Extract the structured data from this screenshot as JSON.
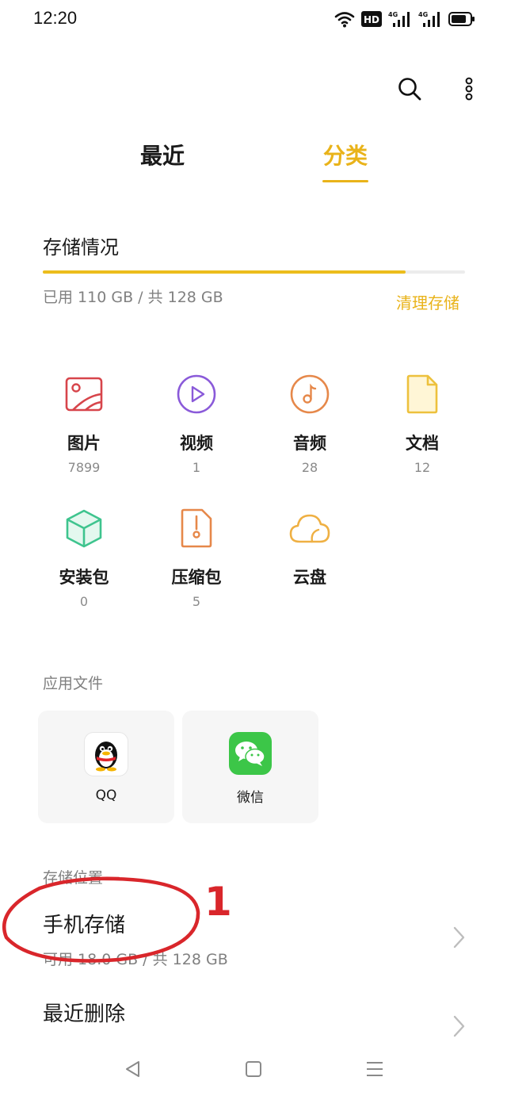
{
  "status_bar": {
    "time": "12:20",
    "icons": [
      "wifi-icon",
      "hd-icon",
      "signal-4g-icon",
      "signal-4g-icon",
      "battery-icon"
    ]
  },
  "toolbar": {
    "icons": [
      "search-icon",
      "more-vertical-icon"
    ]
  },
  "tabs": [
    {
      "label": "最近",
      "active": false
    },
    {
      "label": "分类",
      "active": true
    }
  ],
  "storage": {
    "title": "存储情况",
    "used_text": "已用 110 GB / 共 128 GB",
    "used_fraction": 0.86,
    "clean_label": "清理存储"
  },
  "categories": [
    {
      "label": "图片",
      "count": "7899",
      "icon": "image-icon",
      "color": "#d7454b"
    },
    {
      "label": "视频",
      "count": "1",
      "icon": "video-play-icon",
      "color": "#8a5ad9"
    },
    {
      "label": "音频",
      "count": "28",
      "icon": "music-note-icon",
      "color": "#e6884a"
    },
    {
      "label": "文档",
      "count": "12",
      "icon": "document-icon",
      "color": "#edc13d"
    },
    {
      "label": "安装包",
      "count": "0",
      "icon": "package-cube-icon",
      "color": "#3ec48e"
    },
    {
      "label": "压缩包",
      "count": "5",
      "icon": "zip-file-icon",
      "color": "#e6884a"
    },
    {
      "label": "云盘",
      "count": "",
      "icon": "cloud-icon",
      "color": "#efb043"
    }
  ],
  "app_files": {
    "title": "应用文件",
    "apps": [
      {
        "name": "QQ",
        "icon": "qq-penguin-icon"
      },
      {
        "name": "微信",
        "icon": "wechat-icon",
        "color": "#3cc648"
      }
    ]
  },
  "storage_location": {
    "title": "存储位置",
    "items": [
      {
        "title": "手机存储",
        "subtitle": "可用 18.0 GB / 共 128 GB"
      },
      {
        "title": "最近删除",
        "subtitle": ""
      }
    ]
  },
  "annotation": {
    "number": "1",
    "color": "#d9262b"
  },
  "nav_bar": {
    "icons": [
      "back-triangle-icon",
      "home-square-icon",
      "menu-lines-icon"
    ]
  },
  "colors": {
    "accent": "#e9b31a"
  }
}
